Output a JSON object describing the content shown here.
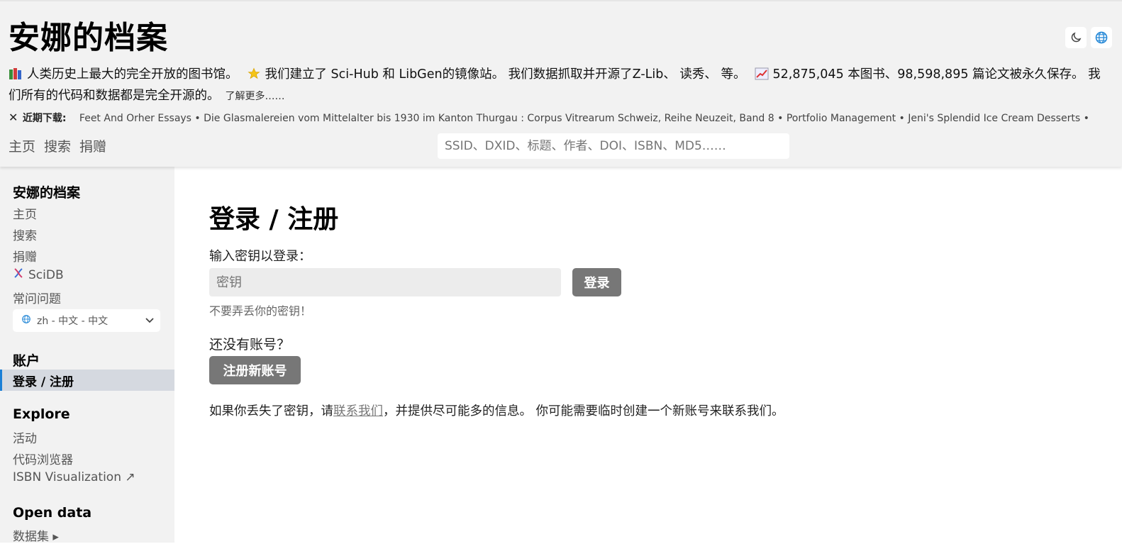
{
  "header": {
    "site_title": "安娜的档案",
    "tagline": {
      "part1": "人类历史上最大的完全开放的图书馆。",
      "part2": "我们建立了 Sci-Hub 和 LibGen的镜像站。 我们数据抓取并开源了Z-Lib、 读秀、 等。",
      "part3": "52,875,045 本图书、98,598,895 篇论文被永久保存。 我们所有的代码和数据都是完全开源的。",
      "learn_more": "了解更多……"
    },
    "recent_close": "✕",
    "recent_label": "近期下载:",
    "recent_items": "Feet And Orher Essays • Die Glasmalereien vom Mittelalter bis 1930 im Kanton Thurgau : Corpus Vitrearum Schweiz, Reihe Neuzeit, Band 8 • Portfolio Management • Jeni's Splendid Ice Cream Desserts •",
    "nav": [
      "主页",
      "搜索",
      "捐赠"
    ],
    "search_placeholder": "SSID、DXID、标题、作者、DOI、ISBN、MD5……",
    "icons": [
      "moon-icon",
      "globe-icon"
    ]
  },
  "sidebar": {
    "section1_title": "安娜的档案",
    "items1": [
      "主页",
      "搜索",
      "捐赠",
      "SciDB",
      "常问问题"
    ],
    "language": "zh - 中文 - 中文",
    "section2_title": "账户",
    "active_item": "登录 / 注册",
    "section3_title": "Explore",
    "items3": [
      "活动",
      "代码浏览器",
      "ISBN Visualization ↗"
    ],
    "section4_title": "Open data",
    "items4": [
      "数据集 ▸"
    ]
  },
  "main": {
    "title": "登录 / 注册",
    "key_label": "输入密钥以登录：",
    "key_placeholder": "密钥",
    "login_button": "登录",
    "hint": "不要弄丢你的密钥！",
    "no_account": "还没有账号？",
    "register_button": "注册新账号",
    "lost_prefix": "如果你丢失了密钥，请",
    "lost_link": "联系我们",
    "lost_suffix": "，并提供尽可能多的信息。 你可能需要临时创建一个新账号来联系我们。"
  },
  "colors": {
    "header_bg": "#f2f2f2",
    "button_bg": "#777777",
    "active_accent": "#1a7fd6"
  }
}
